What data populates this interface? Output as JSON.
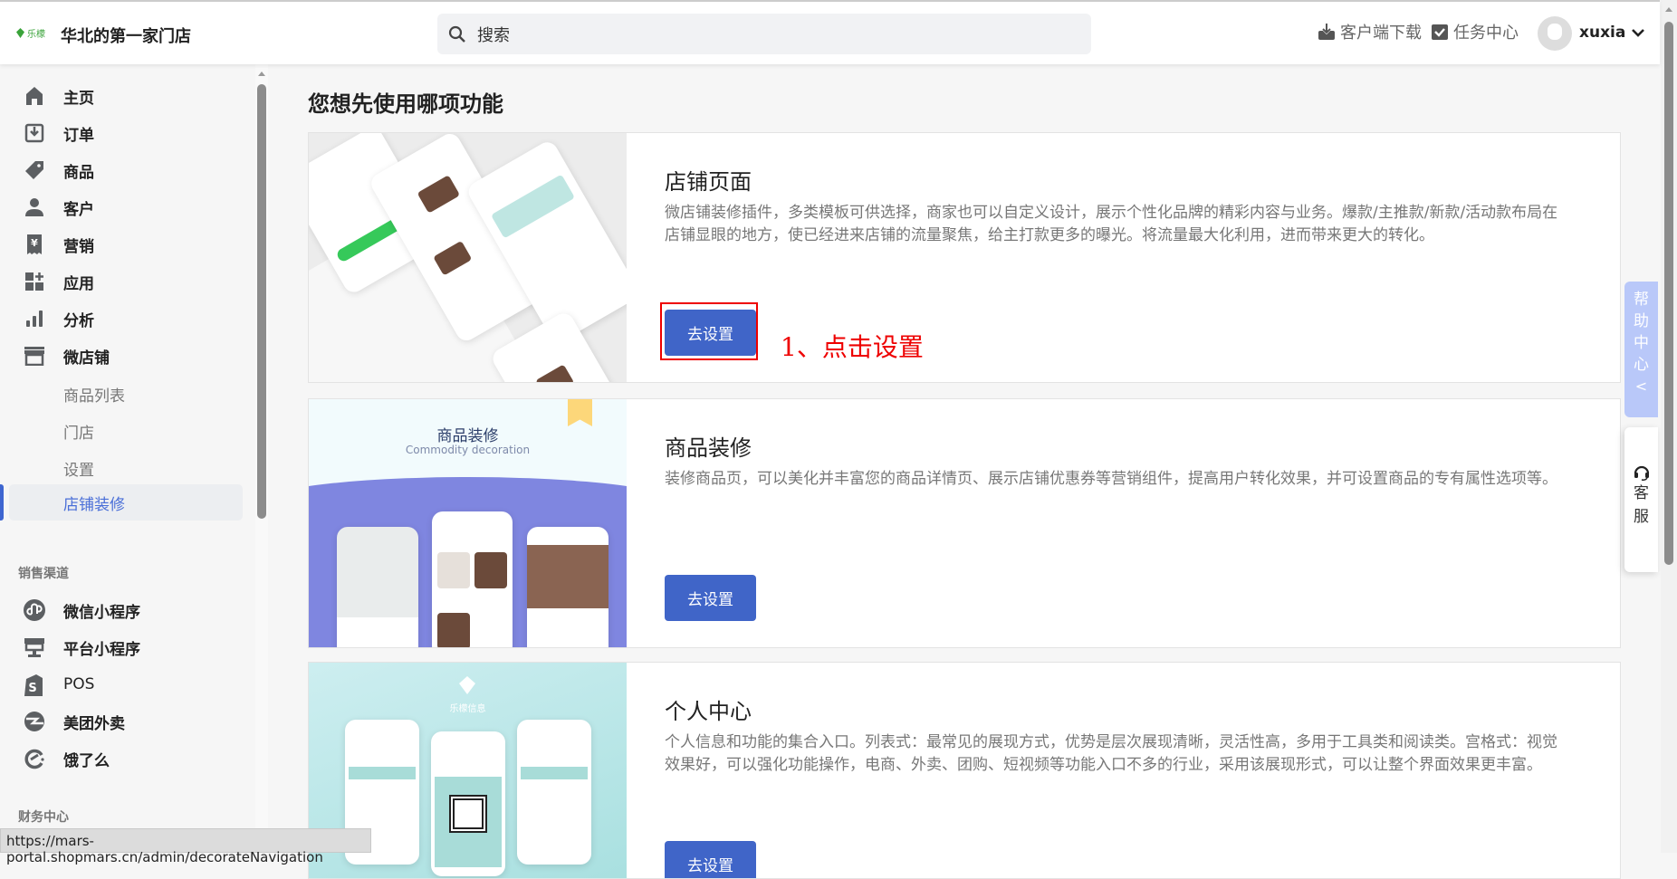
{
  "header": {
    "logo_text": "乐檬",
    "store_name": "华北的第一家门店",
    "search_placeholder": "搜索",
    "download_label": "客户端下载",
    "tasks_label": "任务中心",
    "username": "xuxia"
  },
  "sidebar": {
    "items": [
      {
        "label": "主页",
        "icon": "home-icon"
      },
      {
        "label": "订单",
        "icon": "order-download-icon"
      },
      {
        "label": "商品",
        "icon": "tag-icon"
      },
      {
        "label": "客户",
        "icon": "user-icon"
      },
      {
        "label": "营销",
        "icon": "yen-receipt-icon"
      },
      {
        "label": "应用",
        "icon": "apps-icon"
      },
      {
        "label": "分析",
        "icon": "bar-chart-icon"
      },
      {
        "label": "微店铺",
        "icon": "store-icon"
      }
    ],
    "sub_items": [
      {
        "label": "商品列表"
      },
      {
        "label": "门店"
      },
      {
        "label": "设置"
      },
      {
        "label": "店铺装修"
      }
    ],
    "section_sales": "销售渠道",
    "channels": [
      {
        "label": "微信小程序",
        "icon": "wechat-miniprogram-icon"
      },
      {
        "label": "平台小程序",
        "icon": "platform-store-icon"
      },
      {
        "label": "POS",
        "icon": "shopping-bag-icon"
      },
      {
        "label": "美团外卖",
        "icon": "meituan-icon"
      },
      {
        "label": "饿了么",
        "icon": "eleme-icon"
      }
    ],
    "section_finance": "财务中心"
  },
  "main": {
    "title": "您想先使用哪项功能",
    "cards": [
      {
        "title": "店铺页面",
        "desc": "微店铺装修插件，多类模板可供选择，商家也可以自定义设计，展示个性化品牌的精彩内容与业务。爆款/主推款/新款/活动款布局在店铺显眼的地方，使已经进来店铺的流量聚焦，给主打款更多的曝光。将流量最大化利用，进而带来更大的转化。",
        "button": "去设置"
      },
      {
        "title": "商品装修",
        "desc": "装修商品页，可以美化并丰富您的商品详情页、展示店铺优惠券等营销组件，提高用户转化效果，并可设置商品的专有属性选项等。",
        "button": "去设置",
        "image_title": "商品装修",
        "image_subtitle": "Commodity decoration"
      },
      {
        "title": "个人中心",
        "desc": "个人信息和功能的集合入口。列表式：最常见的展现方式，优势是层次展现清晰，灵活性高，多用于工具类和阅读类。宫格式：视觉效果好，可以强化功能操作，电商、外卖、团购、短视频等功能入口不多的行业，采用该展现形式，可以让整个界面效果更丰富。",
        "button": "去设置",
        "image_brand": "乐檬信息"
      }
    ],
    "annotation": "1、点击设置"
  },
  "float": {
    "help": [
      "帮",
      "助",
      "中",
      "心"
    ],
    "service": [
      "客",
      "服"
    ]
  },
  "status_url": "https://mars-portal.shopmars.cn/admin/decorateNavigation",
  "colors": {
    "primary": "#4065c8",
    "annotation": "#ee0000",
    "help_tab": "#b9c8f9"
  }
}
